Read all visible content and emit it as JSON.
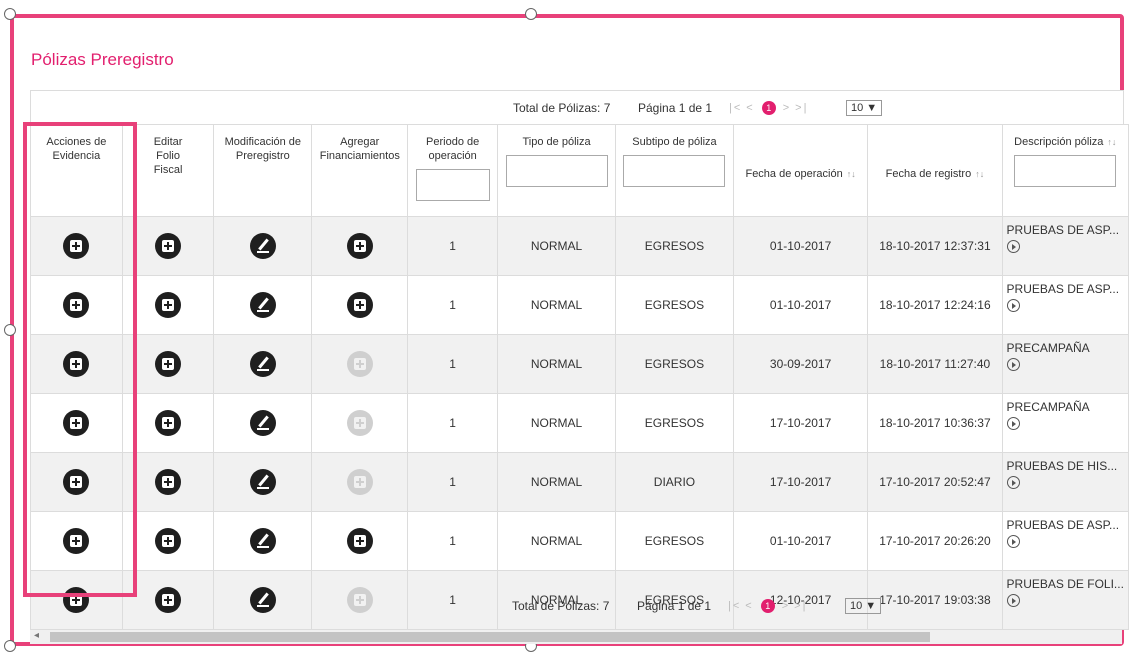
{
  "page": {
    "title": "Pólizas Preregistro"
  },
  "pager": {
    "total": "Total de Pólizas: 7",
    "page": "Página 1 de 1",
    "first": "|<",
    "prev": "<",
    "current": "1",
    "next": ">",
    "last": ">|",
    "page_size": "10 ▼"
  },
  "columns": {
    "acciones": "Acciones de Evidencia",
    "editar": "Editar Folio Fiscal",
    "modificacion": "Modificación de Preregistro",
    "agregar": "Agregar Financiamientos",
    "periodo": "Periodo de operación",
    "tipo": "Tipo de póliza",
    "subtipo": "Subtipo de póliza",
    "fecha_operacion": "Fecha de operación",
    "fecha_registro": "Fecha de registro",
    "descripcion": "Descripción póliza",
    "sort_icon": "↑↓"
  },
  "rows": [
    {
      "periodo": "1",
      "tipo": "NORMAL",
      "subtipo": "EGRESOS",
      "fecha_operacion": "01-10-2017",
      "fecha_registro": "18-10-2017 12:37:31",
      "descripcion": "PRUEBAS DE ASP...",
      "financiamiento_enabled": true
    },
    {
      "periodo": "1",
      "tipo": "NORMAL",
      "subtipo": "EGRESOS",
      "fecha_operacion": "01-10-2017",
      "fecha_registro": "18-10-2017 12:24:16",
      "descripcion": "PRUEBAS DE ASP...",
      "financiamiento_enabled": true
    },
    {
      "periodo": "1",
      "tipo": "NORMAL",
      "subtipo": "EGRESOS",
      "fecha_operacion": "30-09-2017",
      "fecha_registro": "18-10-2017 11:27:40",
      "descripcion": "PRECAMPAÑA",
      "financiamiento_enabled": false
    },
    {
      "periodo": "1",
      "tipo": "NORMAL",
      "subtipo": "EGRESOS",
      "fecha_operacion": "17-10-2017",
      "fecha_registro": "18-10-2017 10:36:37",
      "descripcion": "PRECAMPAÑA",
      "financiamiento_enabled": false
    },
    {
      "periodo": "1",
      "tipo": "NORMAL",
      "subtipo": "DIARIO",
      "fecha_operacion": "17-10-2017",
      "fecha_registro": "17-10-2017 20:52:47",
      "descripcion": "PRUEBAS DE HIS...",
      "financiamiento_enabled": false
    },
    {
      "periodo": "1",
      "tipo": "NORMAL",
      "subtipo": "EGRESOS",
      "fecha_operacion": "01-10-2017",
      "fecha_registro": "17-10-2017 20:26:20",
      "descripcion": "PRUEBAS DE ASP...",
      "financiamiento_enabled": true
    },
    {
      "periodo": "1",
      "tipo": "NORMAL",
      "subtipo": "EGRESOS",
      "fecha_operacion": "12-10-2017",
      "fecha_registro": "17-10-2017 19:03:38",
      "descripcion": "PRUEBAS DE FOLI...",
      "financiamiento_enabled": false
    }
  ],
  "colors": {
    "accent": "#e21f6e",
    "highlight": "#e8417a"
  }
}
